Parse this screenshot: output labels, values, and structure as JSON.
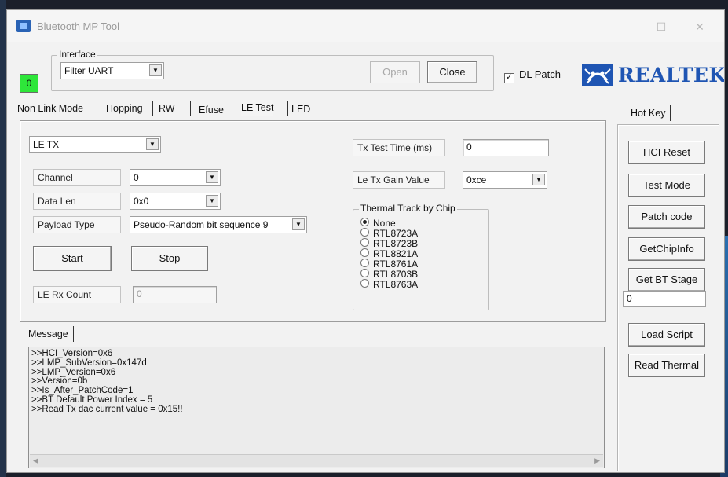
{
  "window": {
    "title": "Bluetooth MP Tool",
    "controls": {
      "minimize": "—",
      "maximize": "☐",
      "close": "✕"
    }
  },
  "status_indicator": {
    "value": "0",
    "color": "#2ee63a"
  },
  "interface": {
    "group_label": "Interface",
    "selected": "Filter UART",
    "open_label": "Open",
    "close_label": "Close",
    "dl_patch_label": "DL Patch",
    "dl_patch_checked": true
  },
  "brand": {
    "text": "REALTEK",
    "color": "#1f55b3"
  },
  "tabs": [
    {
      "label": "Non Link Mode"
    },
    {
      "label": "Hopping"
    },
    {
      "label": "RW"
    },
    {
      "label": "Efuse"
    },
    {
      "label": "LE Test",
      "active": true
    },
    {
      "label": "LED"
    }
  ],
  "le_test": {
    "mode_selected": "LE TX",
    "channel": {
      "label": "Channel",
      "value": "0"
    },
    "data_len": {
      "label": "Data Len",
      "value": "0x0"
    },
    "payload_type": {
      "label": "Payload Type",
      "value": "Pseudo-Random bit sequence 9"
    },
    "start_label": "Start",
    "stop_label": "Stop",
    "rx_count": {
      "label": "LE Rx Count",
      "value": "0"
    },
    "tx_test_time": {
      "label": "Tx Test Time (ms)",
      "value": "0"
    },
    "tx_gain": {
      "label": "Le Tx Gain Value",
      "value": "0xce"
    },
    "thermal": {
      "label": "Thermal Track by Chip",
      "options": [
        "None",
        "RTL8723A",
        "RTL8723B",
        "RTL8821A",
        "RTL8761A",
        "RTL8703B",
        "RTL8763A"
      ],
      "selected_index": 0
    }
  },
  "message": {
    "tab_label": "Message",
    "lines": [
      ">>HCI_Version=0x6",
      ">>LMP_SubVersion=0x147d",
      ">>LMP_Version=0x6",
      ">>Version=0b",
      ">>Is_After_PatchCode=1",
      ">>BT Default Power Index = 5",
      ">>Read Tx dac current value = 0x15!!"
    ]
  },
  "hotkey": {
    "tab_label": "Hot Key",
    "buttons": [
      "HCI Reset",
      "Test Mode",
      "Patch code",
      "GetChipInfo",
      "Get BT Stage"
    ],
    "stage_value": "0",
    "load_script_label": "Load Script",
    "read_thermal_label": "Read Thermal"
  }
}
